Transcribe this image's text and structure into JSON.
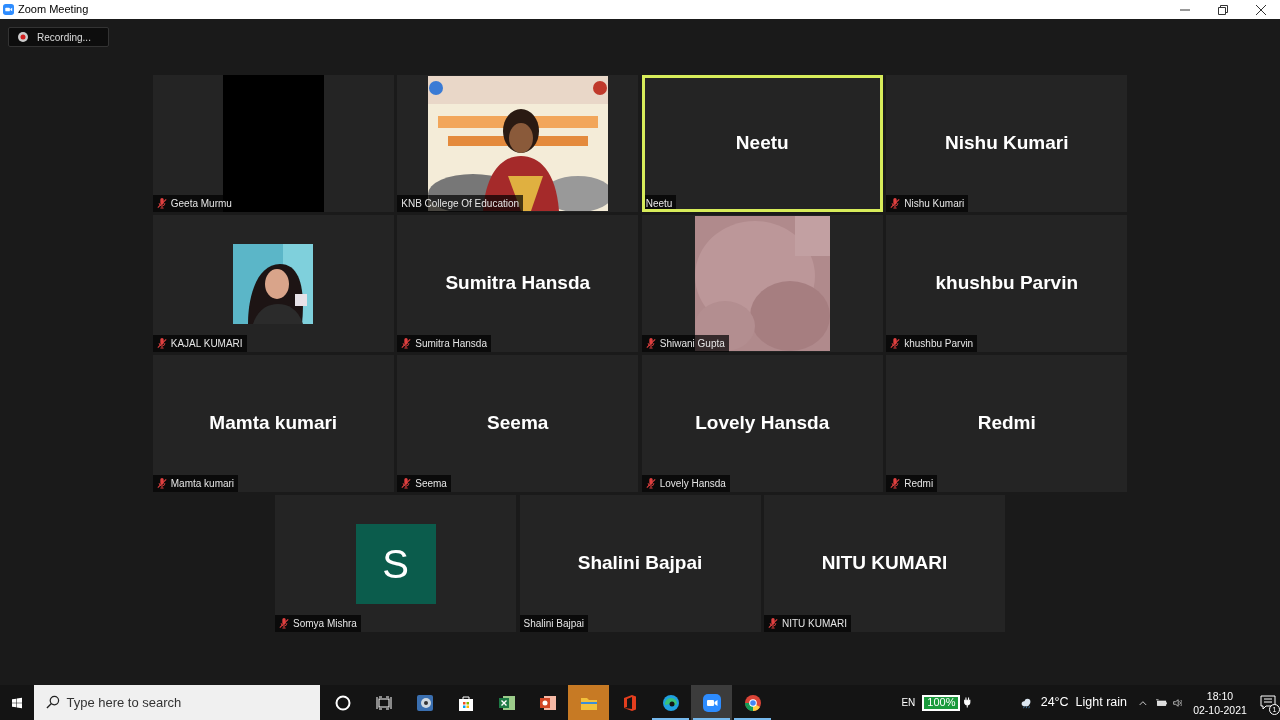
{
  "window": {
    "title": "Zoom Meeting"
  },
  "recording": {
    "label": "Recording..."
  },
  "tile_rows": [
    [
      {
        "kind": "black",
        "label": "Geeta Murmu",
        "muted": true,
        "selected": false
      },
      {
        "kind": "video",
        "label": "KNB College Of Education",
        "muted": false,
        "selected": false
      },
      {
        "kind": "name",
        "display_name": "Neetu",
        "label": "Neetu",
        "muted": false,
        "selected": true
      },
      {
        "kind": "name",
        "display_name": "Nishu Kumari",
        "label": "Nishu Kumari",
        "muted": true,
        "selected": false
      }
    ],
    [
      {
        "label": "KAJAL KUMARI",
        "muted": true,
        "selected": false
      },
      {
        "kind": "name",
        "display_name": "Sumitra Hansda",
        "label": "Sumitra Hansda",
        "muted": true,
        "selected": false
      },
      {
        "kind": "blur",
        "label": "Shiwani Gupta",
        "muted": true,
        "selected": false
      },
      {
        "kind": "name",
        "display_name": "khushbu Parvin",
        "label": "khushbu Parvin",
        "muted": true,
        "selected": false
      }
    ],
    [
      {
        "kind": "name",
        "display_name": "Mamta kumari",
        "label": "Mamta kumari",
        "muted": true,
        "selected": false
      },
      {
        "kind": "name",
        "display_name": "Seema",
        "label": "Seema",
        "muted": true,
        "selected": false
      },
      {
        "kind": "name",
        "display_name": "Lovely Hansda",
        "label": "Lovely Hansda",
        "muted": true,
        "selected": false
      },
      {
        "kind": "name",
        "display_name": "Redmi",
        "label": "Redmi",
        "muted": true,
        "selected": false
      }
    ],
    [
      {
        "kind": "avatar",
        "initial": "S",
        "label": "Somya Mishra",
        "muted": true,
        "selected": false
      },
      {
        "kind": "name",
        "display_name": "Shalini Bajpai",
        "label": "Shalini Bajpai",
        "muted": false,
        "selected": false
      },
      {
        "kind": "name",
        "display_name": "NITU KUMARI",
        "label": "NITU KUMARI",
        "muted": true,
        "selected": false
      }
    ]
  ],
  "taskbar": {
    "search": {
      "placeholder": "Type here to search"
    },
    "apps": [
      {
        "kind": "cortana",
        "running": false,
        "selected": false
      },
      {
        "kind": "taskview",
        "running": false,
        "selected": false
      },
      {
        "kind": "media",
        "running": false,
        "selected": false
      },
      {
        "kind": "store",
        "running": false,
        "selected": false
      },
      {
        "kind": "excel",
        "running": false,
        "selected": false
      },
      {
        "kind": "powerpoint",
        "running": false,
        "selected": false
      },
      {
        "kind": "explorer",
        "running": false,
        "selected": false,
        "attention": true
      },
      {
        "kind": "office",
        "running": false,
        "selected": false
      },
      {
        "kind": "edge",
        "running": true,
        "selected": false
      },
      {
        "kind": "zoom",
        "running": true,
        "selected": true
      },
      {
        "kind": "chrome",
        "running": true,
        "selected": false
      }
    ],
    "language": "EN",
    "battery": "100%",
    "weather": "24°C  Light rain",
    "time": "18:10",
    "date": "02-10-2021",
    "notifications": "1"
  }
}
